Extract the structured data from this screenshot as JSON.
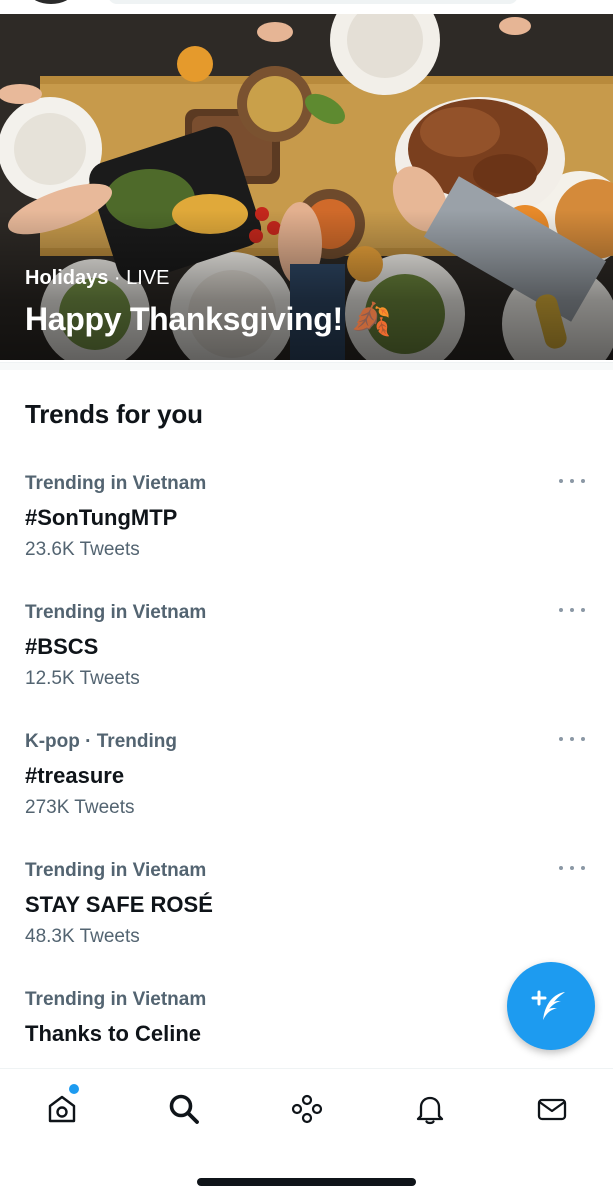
{
  "hero": {
    "category": "Holidays",
    "separator": "·",
    "status": "LIVE",
    "title": "Happy Thanksgiving! 🍂"
  },
  "trends_section": {
    "title": "Trends for you",
    "items": [
      {
        "context": "Trending in Vietnam",
        "name": "#SonTungMTP",
        "count": "23.6K Tweets"
      },
      {
        "context": "Trending in Vietnam",
        "name": "#BSCS",
        "count": "12.5K Tweets"
      },
      {
        "context": "K-pop · Trending",
        "name": "#treasure",
        "count": "273K Tweets"
      },
      {
        "context": "Trending in Vietnam",
        "name": "STAY SAFE ROSÉ",
        "count": "48.3K Tweets"
      },
      {
        "context": "Trending in Vietnam",
        "name": "Thanks to Celine",
        "count": ""
      }
    ]
  },
  "compose_button": {
    "icon": "feather-plus-icon"
  },
  "bottom_nav": {
    "items": [
      {
        "icon": "home-icon",
        "active": false,
        "has_notification_dot": true
      },
      {
        "icon": "search-icon",
        "active": true
      },
      {
        "icon": "spaces-icon",
        "active": false
      },
      {
        "icon": "bell-icon",
        "active": false
      },
      {
        "icon": "mail-icon",
        "active": false
      }
    ]
  },
  "colors": {
    "accent": "#1d9bf0",
    "text_primary": "#0f1419",
    "text_secondary": "#536471"
  }
}
